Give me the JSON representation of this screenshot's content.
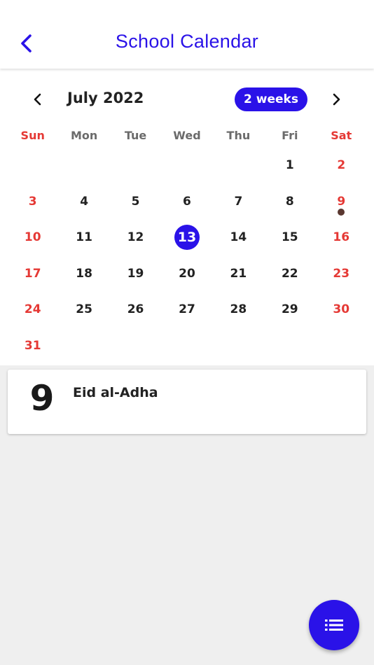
{
  "appbar": {
    "title": "School Calendar",
    "back_icon": "chevron-left-icon"
  },
  "calendar": {
    "month_label": "July 2022",
    "format_button": "2 weeks",
    "weekdays": [
      "Sun",
      "Mon",
      "Tue",
      "Wed",
      "Thu",
      "Fri",
      "Sat"
    ],
    "weeks": [
      [
        "",
        "",
        "",
        "",
        "",
        "1",
        "2"
      ],
      [
        "3",
        "4",
        "5",
        "6",
        "7",
        "8",
        "9"
      ],
      [
        "10",
        "11",
        "12",
        "13",
        "14",
        "15",
        "16"
      ],
      [
        "17",
        "18",
        "19",
        "20",
        "21",
        "22",
        "23"
      ],
      [
        "24",
        "25",
        "26",
        "27",
        "28",
        "29",
        "30"
      ],
      [
        "31",
        "",
        "",
        "",
        "",
        "",
        ""
      ]
    ],
    "selected_day": "13",
    "event_days": [
      "9"
    ]
  },
  "event": {
    "day": "9",
    "title": "Eid al-Adha"
  },
  "colors": {
    "accent": "#2a12e8",
    "weekend": "#e53935",
    "event_dot": "#5a3730"
  },
  "fab": {
    "icon": "list-icon"
  }
}
